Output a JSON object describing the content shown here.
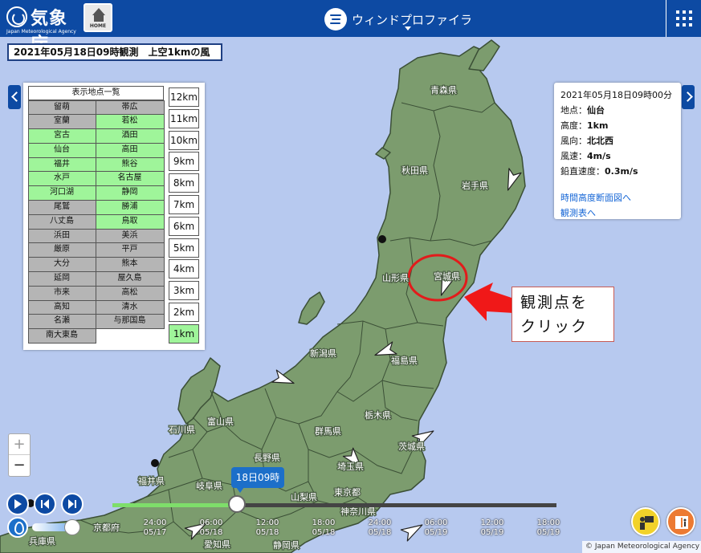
{
  "header": {
    "agency_name": "気象庁",
    "agency_english": "Japan Meteorological Agency",
    "home_label": "HOME",
    "app_title": "ウィンドプロファイラ"
  },
  "observation_label": "2021年05月18日09時観測　上空1kmの風",
  "station_list": {
    "title": "表示地点一覧",
    "stations": [
      {
        "name": "留萌",
        "state": "gray"
      },
      {
        "name": "帯広",
        "state": "gray"
      },
      {
        "name": "室蘭",
        "state": "gray"
      },
      {
        "name": "若松",
        "state": "active"
      },
      {
        "name": "宮古",
        "state": "active"
      },
      {
        "name": "酒田",
        "state": "active"
      },
      {
        "name": "仙台",
        "state": "active"
      },
      {
        "name": "高田",
        "state": "active"
      },
      {
        "name": "福井",
        "state": "active"
      },
      {
        "name": "熊谷",
        "state": "active"
      },
      {
        "name": "水戸",
        "state": "active"
      },
      {
        "name": "名古屋",
        "state": "active"
      },
      {
        "name": "河口湖",
        "state": "active"
      },
      {
        "name": "静岡",
        "state": "active"
      },
      {
        "name": "尾鷲",
        "state": "gray"
      },
      {
        "name": "勝浦",
        "state": "active"
      },
      {
        "name": "八丈島",
        "state": "gray"
      },
      {
        "name": "鳥取",
        "state": "active"
      },
      {
        "name": "浜田",
        "state": "gray"
      },
      {
        "name": "美浜",
        "state": "gray"
      },
      {
        "name": "厳原",
        "state": "gray"
      },
      {
        "name": "平戸",
        "state": "gray"
      },
      {
        "name": "大分",
        "state": "gray"
      },
      {
        "name": "熊本",
        "state": "gray"
      },
      {
        "name": "延岡",
        "state": "gray"
      },
      {
        "name": "屋久島",
        "state": "gray"
      },
      {
        "name": "市来",
        "state": "gray"
      },
      {
        "name": "高松",
        "state": "gray"
      },
      {
        "name": "高知",
        "state": "gray"
      },
      {
        "name": "清水",
        "state": "gray"
      },
      {
        "name": "名瀬",
        "state": "gray"
      },
      {
        "name": "与那国島",
        "state": "gray"
      },
      {
        "name": "南大東島",
        "state": "gray"
      }
    ],
    "altitudes": [
      "12km",
      "11km",
      "10km",
      "9km",
      "8km",
      "7km",
      "6km",
      "5km",
      "4km",
      "3km",
      "2km",
      "1km"
    ],
    "selected_altitude": "1km"
  },
  "info": {
    "datetime": "2021年05月18日09時00分",
    "location_label": "地点：",
    "location_value": "仙台",
    "altitude_label": "高度：",
    "altitude_value": "1km",
    "direction_label": "風向：",
    "direction_value": "北北西",
    "speed_label": "風速：",
    "speed_value": "4m/s",
    "vertical_label": "鉛直速度：",
    "vertical_value": "0.3m/s",
    "link_time_height": "時間高度断面図へ",
    "link_table": "観測表へ"
  },
  "callout": {
    "line1": "観測点を",
    "line2": "クリック"
  },
  "map_labels": {
    "aomori": "青森県",
    "akita": "秋田県",
    "iwate": "岩手県",
    "yamagata": "山形県",
    "miyagi": "宮城県",
    "niigata": "新潟県",
    "fukushima": "福島県",
    "tochigi": "栃木県",
    "gunma": "群馬県",
    "ibaraki": "茨城県",
    "toyama": "富山県",
    "ishikawa": "石川県",
    "nagano": "長野県",
    "saitama": "埼玉県",
    "fukui": "福井県",
    "gifu": "岐阜県",
    "yamanashi": "山梨県",
    "tokyo": "東京都",
    "kanagawa": "神奈川県",
    "kyoto": "京都府",
    "hyogo": "兵庫県",
    "aichi": "愛知県",
    "shizuoka": "静岡県"
  },
  "zoom": {
    "plus": "+",
    "minus": "−"
  },
  "timeline": {
    "current": "18日09時",
    "progress": 0.28,
    "ticks": [
      {
        "time": "24:00",
        "date": "05/17"
      },
      {
        "time": "06:00",
        "date": "05/18"
      },
      {
        "time": "12:00",
        "date": "05/18"
      },
      {
        "time": "18:00",
        "date": "05/18"
      },
      {
        "time": "24:00",
        "date": "05/18"
      },
      {
        "time": "06:00",
        "date": "05/19"
      },
      {
        "time": "12:00",
        "date": "05/19"
      },
      {
        "time": "18:00",
        "date": "05/19"
      }
    ]
  },
  "opacity_level": 0.9,
  "copyright": "© Japan Meteorological Agency",
  "colors": {
    "header": "#0d4aa3",
    "sea": "#b7c9ef",
    "land": "#7c9c6e",
    "active_station": "#9ff59a",
    "inactive_station": "#b5b5b5",
    "highlight": "#e21b1b"
  }
}
